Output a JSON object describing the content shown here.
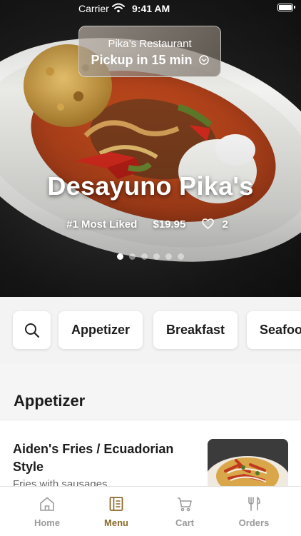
{
  "status_bar": {
    "carrier": "Carrier",
    "time": "9:41 AM"
  },
  "restaurant": {
    "name": "Pika’s Restaurant",
    "pickup": "Pickup in 15 min"
  },
  "featured": {
    "title": "Desayuno Pika's",
    "badge": "#1 Most Liked",
    "price": "$19.95",
    "likes": "2",
    "carousel": {
      "count": 6,
      "active_index": 0
    }
  },
  "categories": {
    "search_icon": "search-icon",
    "items": [
      "Appetizer",
      "Breakfast",
      "Seafood"
    ]
  },
  "section": {
    "title": "Appetizer"
  },
  "menu_items": [
    {
      "name": "Aiden's Fries / Ecuadorian Style",
      "description": "Fries with sausages"
    }
  ],
  "tabs": [
    {
      "label": "Home",
      "icon": "home-icon",
      "active": false
    },
    {
      "label": "Menu",
      "icon": "menu-icon",
      "active": true
    },
    {
      "label": "Cart",
      "icon": "cart-icon",
      "active": false
    },
    {
      "label": "Orders",
      "icon": "orders-icon",
      "active": false
    }
  ],
  "colors": {
    "accent": "#8a6a2a",
    "tab_inactive": "#9a9a9a"
  }
}
